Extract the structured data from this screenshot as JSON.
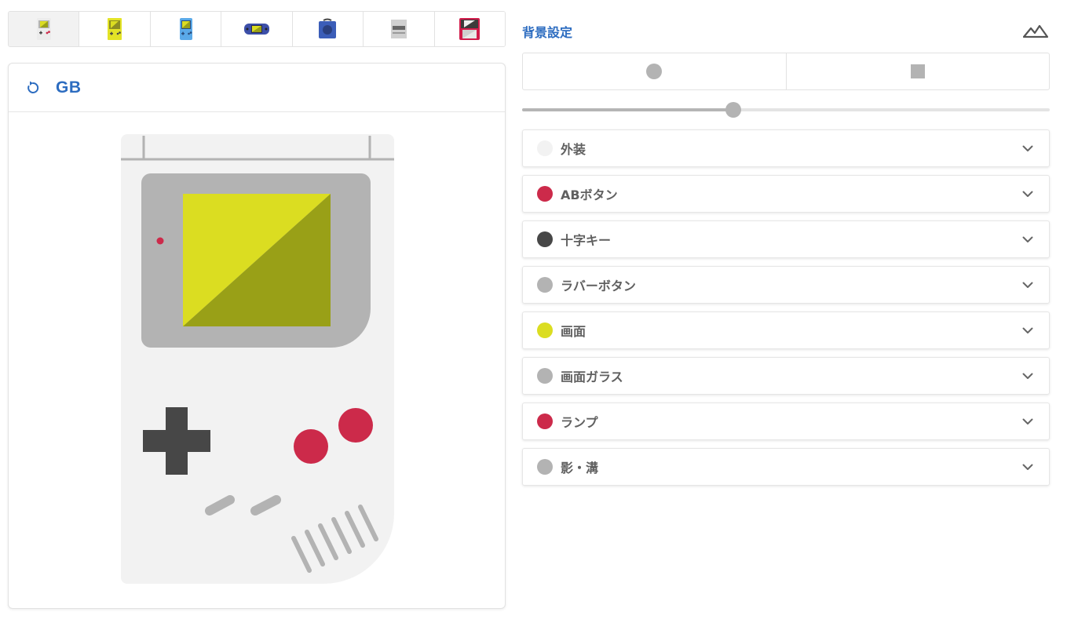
{
  "device_tabs": [
    {
      "name": "gb",
      "active": true
    },
    {
      "name": "gb-pocket-yellow",
      "active": false
    },
    {
      "name": "gb-color",
      "active": false
    },
    {
      "name": "gba",
      "active": false
    },
    {
      "name": "gamecube",
      "active": false
    },
    {
      "name": "sfc",
      "active": false
    },
    {
      "name": "3ds",
      "active": false
    }
  ],
  "preview": {
    "title": "GB",
    "reset_icon": "reset-icon"
  },
  "background": {
    "title": "背景設定",
    "image_icon": "mountain-icon",
    "shape_options": [
      "circle",
      "square"
    ],
    "slider_value": 0.4
  },
  "parts": [
    {
      "label": "外装",
      "color": "#f2f2f2"
    },
    {
      "label": "ABボタン",
      "color": "#cc2a4a"
    },
    {
      "label": "十字キー",
      "color": "#474747"
    },
    {
      "label": "ラバーボタン",
      "color": "#b3b3b3"
    },
    {
      "label": "画面",
      "color": "#dbdd21"
    },
    {
      "label": "画面ガラス",
      "color": "#b3b3b3"
    },
    {
      "label": "ランプ",
      "color": "#cc2a4a"
    },
    {
      "label": "影・溝",
      "color": "#b3b3b3"
    }
  ],
  "gb_colors": {
    "body": "#f2f2f2",
    "groove": "#b3b3b3",
    "glass": "#b3b3b3",
    "screen_light": "#dbdd21",
    "screen_dark": "#99a017",
    "ab": "#cc2a4a",
    "dpad": "#474747",
    "lamp": "#cc2a4a"
  }
}
